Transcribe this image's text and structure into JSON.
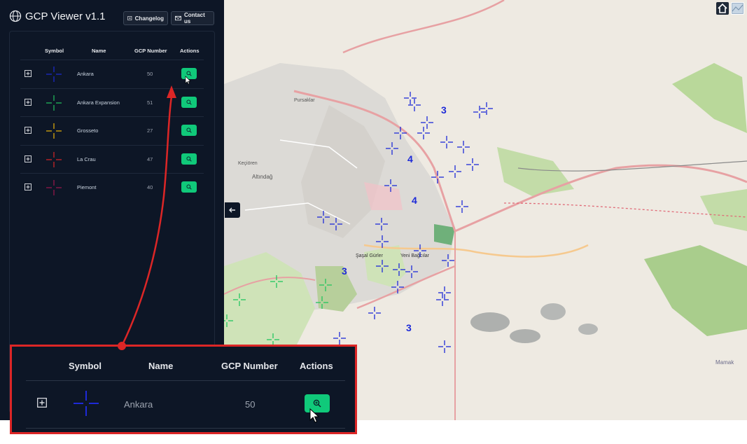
{
  "app": {
    "title": "GCP Viewer v1.1",
    "changelog_label": "Changelog",
    "contact_label": "Contact us"
  },
  "table": {
    "headers": {
      "symbol": "Symbol",
      "name": "Name",
      "gcp_number": "GCP Number",
      "actions": "Actions"
    },
    "rows": [
      {
        "name": "Ankara",
        "gcp_number": "50",
        "color": "#1d2ad8"
      },
      {
        "name": "Ankara Expansion",
        "gcp_number": "51",
        "color": "#22c55e"
      },
      {
        "name": "Grosseto",
        "gcp_number": "27",
        "color": "#eab308"
      },
      {
        "name": "La Crau",
        "gcp_number": "47",
        "color": "#dc2626"
      },
      {
        "name": "Piemont",
        "gcp_number": "40",
        "color": "#9d174d"
      }
    ]
  },
  "map": {
    "cluster_labels": [
      "3",
      "4",
      "4",
      "3",
      "3"
    ],
    "place_labels": [
      "Pursaklar",
      "Altındağ",
      "Keçiören",
      "Mamak",
      "Yeni Bağcılar",
      "Şaşal Gürler"
    ]
  },
  "zoom_callout": {
    "headers": {
      "symbol": "Symbol",
      "name": "Name",
      "gcp_number": "GCP Number",
      "actions": "Actions"
    },
    "row": {
      "name": "Ankara",
      "gcp_number": "50",
      "color": "#1d2ad8"
    }
  },
  "colors": {
    "sidebar_bg": "#0d1626",
    "action_green": "#10c97a",
    "highlight_red": "#dc2626"
  },
  "icons": [
    "globe-icon",
    "changelog-icon",
    "mail-icon",
    "plus-icon",
    "crosshair-icon",
    "zoom-icon",
    "arrow-left-icon",
    "home-icon",
    "layers-icon",
    "cursor-icon"
  ]
}
